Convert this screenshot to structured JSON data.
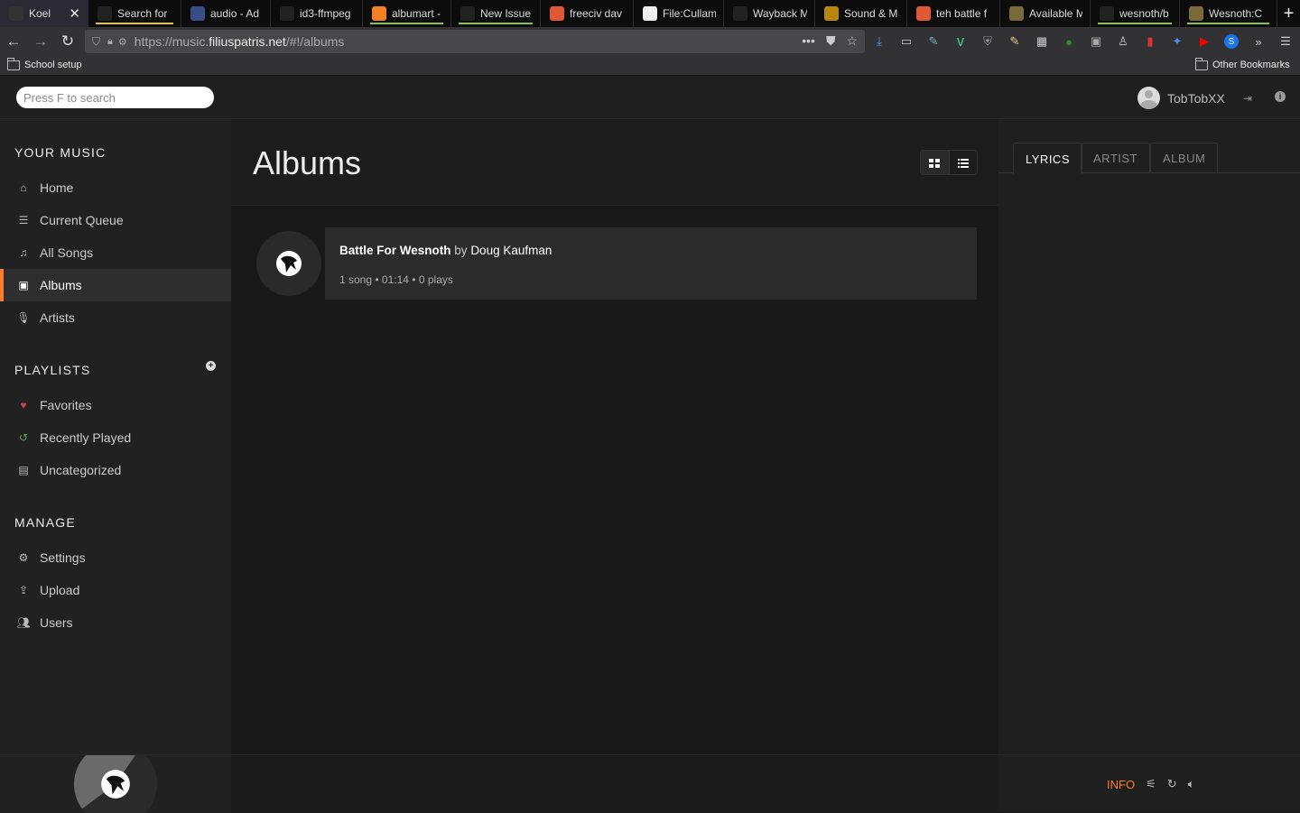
{
  "browser": {
    "tabs": [
      {
        "label": "Koel",
        "active": true,
        "icon": "koel-icon",
        "color": "#333333"
      },
      {
        "label": "Search for",
        "icon": "search-icon",
        "color": "#222222",
        "underline": "#e8c33b"
      },
      {
        "label": "audio - Ad",
        "icon": "audio-icon",
        "color": "#3a4d86"
      },
      {
        "label": "id3-ffmpeg",
        "icon": "github-icon",
        "color": "#222222"
      },
      {
        "label": "albumart -",
        "icon": "stackoverflow-icon",
        "color": "#f48024",
        "underline": "#8bc34a"
      },
      {
        "label": "New Issue",
        "icon": "github-icon",
        "color": "#222222",
        "underline": "#8bc34a"
      },
      {
        "label": "freeciv dav",
        "icon": "duckduckgo-icon",
        "color": "#de5833"
      },
      {
        "label": "File:Cullam",
        "icon": "wikipedia-icon",
        "color": "#eeeeee"
      },
      {
        "label": "Wayback Mach",
        "icon": "wayback-icon",
        "color": "#222222"
      },
      {
        "label": "Sound & M",
        "icon": "sound-icon",
        "color": "#b8860b"
      },
      {
        "label": "teh battle f",
        "icon": "duckduckgo-icon",
        "color": "#de5833"
      },
      {
        "label": "Available M",
        "icon": "wesnoth-icon",
        "color": "#7a6a3a"
      },
      {
        "label": "wesnoth/b",
        "icon": "github-icon",
        "color": "#222222",
        "underline": "#8bc34a"
      },
      {
        "label": "Wesnoth:C",
        "icon": "wesnoth-icon",
        "color": "#7a6a3a",
        "underline": "#8bc34a"
      }
    ],
    "close_glyph": "✕",
    "new_tab_glyph": "+",
    "url_prefix": "https://music.",
    "url_host": "filiuspatris.net",
    "url_path": "/#!/albums",
    "bookmark_left": "School setup",
    "bookmark_right": "Other Bookmarks"
  },
  "header": {
    "search_placeholder": "Press F to search",
    "username": "TobTobXX"
  },
  "sidebar": {
    "your_music_title": "YOUR MUSIC",
    "music_items": [
      {
        "label": "Home",
        "icon": "home-icon"
      },
      {
        "label": "Current Queue",
        "icon": "queue-icon"
      },
      {
        "label": "All Songs",
        "icon": "music-note-icon"
      },
      {
        "label": "Albums",
        "icon": "album-icon",
        "active": true
      },
      {
        "label": "Artists",
        "icon": "microphone-icon"
      }
    ],
    "playlists_title": "PLAYLISTS",
    "playlist_items": [
      {
        "label": "Favorites",
        "icon": "heart-icon",
        "color": "#c34848"
      },
      {
        "label": "Recently Played",
        "icon": "history-icon",
        "color": "#56a052"
      },
      {
        "label": "Uncategorized",
        "icon": "file-icon",
        "color": "#bbbbbb"
      }
    ],
    "manage_title": "MANAGE",
    "manage_items": [
      {
        "label": "Settings",
        "icon": "gear-icon"
      },
      {
        "label": "Upload",
        "icon": "upload-icon"
      },
      {
        "label": "Users",
        "icon": "users-icon"
      }
    ]
  },
  "main": {
    "title": "Albums",
    "album": {
      "name": "Battle For Wesnoth",
      "by": "by",
      "artist": "Doug Kaufman",
      "songs": "1 song",
      "duration": "01:14",
      "plays": "0 plays",
      "separator": "•"
    }
  },
  "extra": {
    "tabs": [
      "LYRICS",
      "ARTIST",
      "ALBUM"
    ],
    "active_tab": "LYRICS"
  },
  "footer": {
    "info_label": "INFO"
  },
  "colors": {
    "accent": "#ff7d2e",
    "background": "#181818",
    "sidebar": "#212121"
  }
}
